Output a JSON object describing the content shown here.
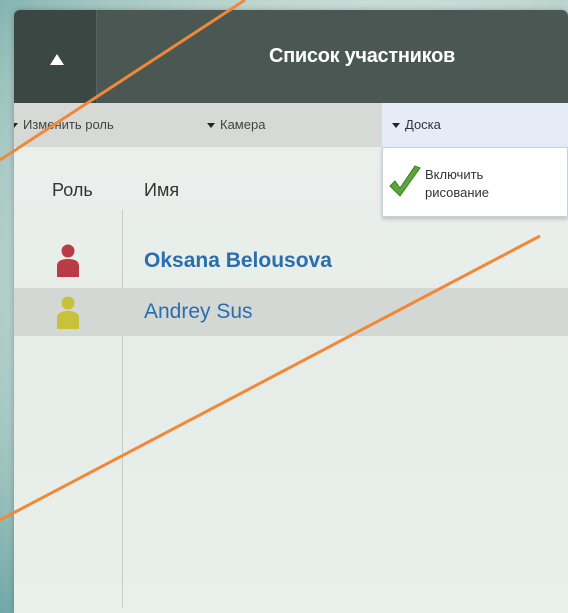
{
  "header": {
    "title": "Список участников",
    "collapse_icon": "triangle-up-icon"
  },
  "toolbar": {
    "change_role": "Изменить роль",
    "camera": "Камера",
    "board": "Доска"
  },
  "dropdown": {
    "item_line1": "Включить",
    "item_line2": "рисование",
    "item_icon": "checkmark-icon"
  },
  "table": {
    "columns": [
      "Роль",
      "Имя"
    ],
    "rows": [
      {
        "name": "Oksana Belousova",
        "role_icon": "user-icon",
        "role_color": "#b83b45"
      },
      {
        "name": "Andrey Sus",
        "role_icon": "user-icon",
        "role_color": "#c7c23a"
      }
    ]
  },
  "colors": {
    "accent_link": "#2a6ead",
    "header_bg": "#4a5753",
    "annotation_line": "#f0883a"
  }
}
